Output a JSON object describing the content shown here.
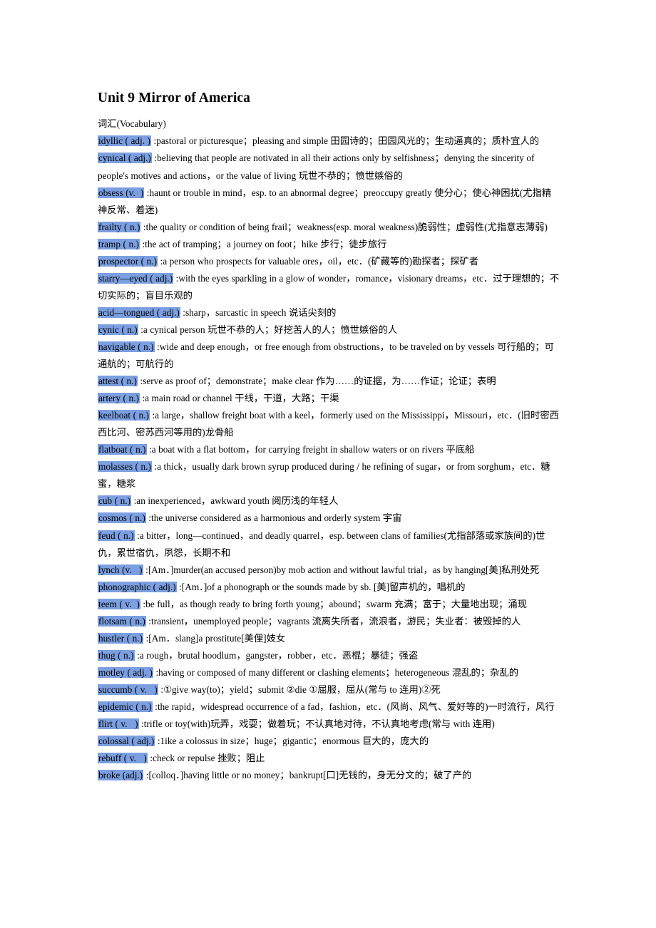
{
  "document": {
    "title": "Unit 9 Mirror of America",
    "section_label": "词汇(Vocabulary)",
    "highlight_color": "#7b9fe0",
    "entries": [
      {
        "headword": "idyllic ( adj. )",
        "definition": " :pastoral or picturesque；pleasing and simple  田园诗的；田园风光的；生动逼真的；质朴宜人的"
      },
      {
        "headword": "cynical ( adj.)",
        "definition": " :believing that people are notivated in all their actions only by selfishness；denying the sincerity of people's motives and actions，or the value of living 玩世不恭的；愤世嫉俗的"
      },
      {
        "headword": "obsess (v.  )",
        "definition": " :haunt or trouble in mind，esp. to an abnormal degree；preoccupy greatly 使分心；使心神困扰(尤指精神反常、着迷)"
      },
      {
        "headword": "frailty ( n.)",
        "definition": " :the quality or condition of being frail；weakness(esp. moral weakness)脆弱性；虚弱性(尤指意志薄弱)"
      },
      {
        "headword": "tramp ( n.)",
        "definition": " :the act of tramping；a journey on foot；hike 步行；徒步旅行"
      },
      {
        "headword": "prospector ( n.)",
        "definition": " :a person who prospects for valuable ores，oil，etc．(矿藏等的)勘探者；探矿者"
      },
      {
        "headword": "starry—eyed ( adj.)",
        "definition": " :with the eyes sparkling in a glow of wonder，romance，visionary dreams，etc．过于理想的；不切实际的；盲目乐观的"
      },
      {
        "headword": "acid—tongued ( adj.)",
        "definition": " :sharp，sarcastic in speech 说话尖刻的"
      },
      {
        "headword": "cynic ( n.)",
        "definition": " :a cynical person 玩世不恭的人；好挖苦人的人；愤世嫉俗的人"
      },
      {
        "headword": "navigable ( n.)",
        "definition": " :wide and deep enough，or free enough from obstructions，to be traveled on by vessels 可行船的；可通航的；可航行的"
      },
      {
        "headword": "attest ( n.)",
        "definition": " :serve as proof of；demonstrate；make clear 作为……的证据，为……作证；论证；表明"
      },
      {
        "headword": "artery ( n.)",
        "definition": " :a main road or channel 干线，干道，大路；干渠"
      },
      {
        "headword": "keelboat ( n.)",
        "definition": " :a large，shallow freight boat with a keel，formerly used on the Mississippi，Missouri，etc．(旧时密西西比河、密苏西河等用的)龙骨船"
      },
      {
        "headword": "flatboat ( n.)",
        "definition": " :a boat with a flat bottom，for carrying freight in shallow waters or on rivers 平底船"
      },
      {
        "headword": "molasses ( n.)",
        "definition": " :a thick，usually dark brown syrup produced during / he refining of sugar，or from sorghum，etc．糖蜜，糖浆"
      },
      {
        "headword": "cub ( n.)",
        "definition": " :an inexperienced，awkward youth 阅历浅的年轻人"
      },
      {
        "headword": "cosmos ( n.)",
        "definition": " :the universe considered as a harmonious and orderly system 宇宙"
      },
      {
        "headword": "feud ( n.)",
        "definition": " :a bitter，long—continued，and deadly quarrel，esp. between clans of families(尤指部落或家族间的)世仇，累世宿仇，夙怨，长期不和"
      },
      {
        "headword": "lynch (v.   )",
        "definition": " :[Am．]murder(an accused person)by mob action and without lawful trial，as by hanging[美]私刑处死"
      },
      {
        "headword": "phonographic ( adj.)",
        "definition": " :[Am．]of a phonograph or the sounds made by sb. [美]留声机的，唱机的"
      },
      {
        "headword": "teem ( v.  )",
        "definition": " :be full，as though ready to bring forth young；abound；swarm 充满；富于；大量地出现；涌现"
      },
      {
        "headword": "flotsam ( n.)",
        "definition": " :transient，unemployed people；vagrants 流离失所者，流浪者，游民；失业者：被毁掉的人"
      },
      {
        "headword": "hustler ( n.)",
        "definition": " :[Am．slang]a prostitute[美俚]妓女"
      },
      {
        "headword": "thug ( n.)",
        "definition": " :a rough，brutal hoodlum，gangster，robber，etc．恶棍；暴徒；强盗"
      },
      {
        "headword": "motley ( adj. )",
        "definition": " :having or composed of many different or clashing elements；heterogeneous 混乱的；杂乱的"
      },
      {
        "headword": "succumb ( v.   )",
        "definition": " :①give way(to)；yield；submit ②die ①屈服，屈从(常与 to 连用)②死"
      },
      {
        "headword": "epidemic ( n.)",
        "definition": " :the rapid，widespread occurrence of a fad，fashion，etc．(风尚、风气、爱好等的)一时流行，风行"
      },
      {
        "headword": "flirt ( v.   )",
        "definition": " :trifle or toy(with)玩弄，戏耍；做着玩；不认真地对待，不认真地考虑(常与 with 连用)"
      },
      {
        "headword": "colossal ( adj.)",
        "definition": " :1ike a colossus in size；huge；gigantic；enormous 巨大的，庞大的"
      },
      {
        "headword": "rebuff ( v.   )",
        "definition": " :check or repulse 挫败；阻止"
      },
      {
        "headword": "broke (adj.)",
        "definition": " :[colloq．]having little or no money；bankrupt[口]无钱的，身无分文的；破了产的"
      }
    ]
  }
}
